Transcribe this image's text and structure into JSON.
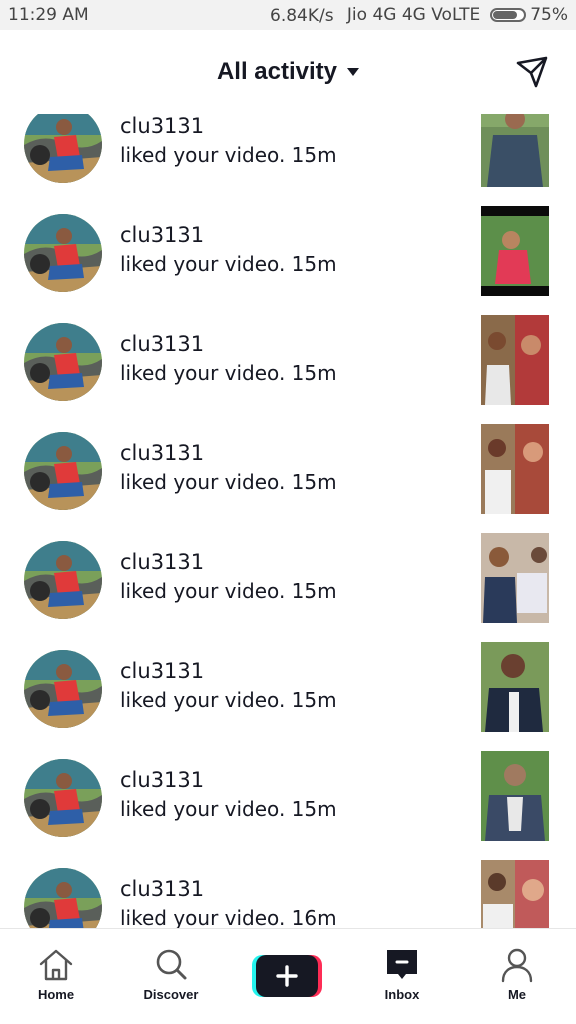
{
  "status_bar": {
    "time": "11:29 AM",
    "network_speed": "6.84K/s",
    "carrier": "Jio 4G 4G VoLTE",
    "battery": "75%",
    "battery_level": 0.75
  },
  "header": {
    "title": "All activity",
    "title_icon": "chevron-down-icon",
    "action_icon": "send-message-icon"
  },
  "notifications": [
    {
      "username": "clu3131",
      "message": "liked your video. 15m"
    },
    {
      "username": "clu3131",
      "message": "liked your video. 15m"
    },
    {
      "username": "clu3131",
      "message": "liked your video. 15m"
    },
    {
      "username": "clu3131",
      "message": "liked your video. 15m"
    },
    {
      "username": "clu3131",
      "message": "liked your video. 15m"
    },
    {
      "username": "clu3131",
      "message": "liked your video. 15m"
    },
    {
      "username": "clu3131",
      "message": "liked your video. 15m"
    },
    {
      "username": "clu3131",
      "message": "liked your video. 16m"
    }
  ],
  "tabbar": {
    "home": "Home",
    "discover": "Discover",
    "inbox": "Inbox",
    "me": "Me"
  },
  "colors": {
    "text": "#161823",
    "create_cyan": "#25f4ee",
    "create_red": "#fe2c55"
  }
}
